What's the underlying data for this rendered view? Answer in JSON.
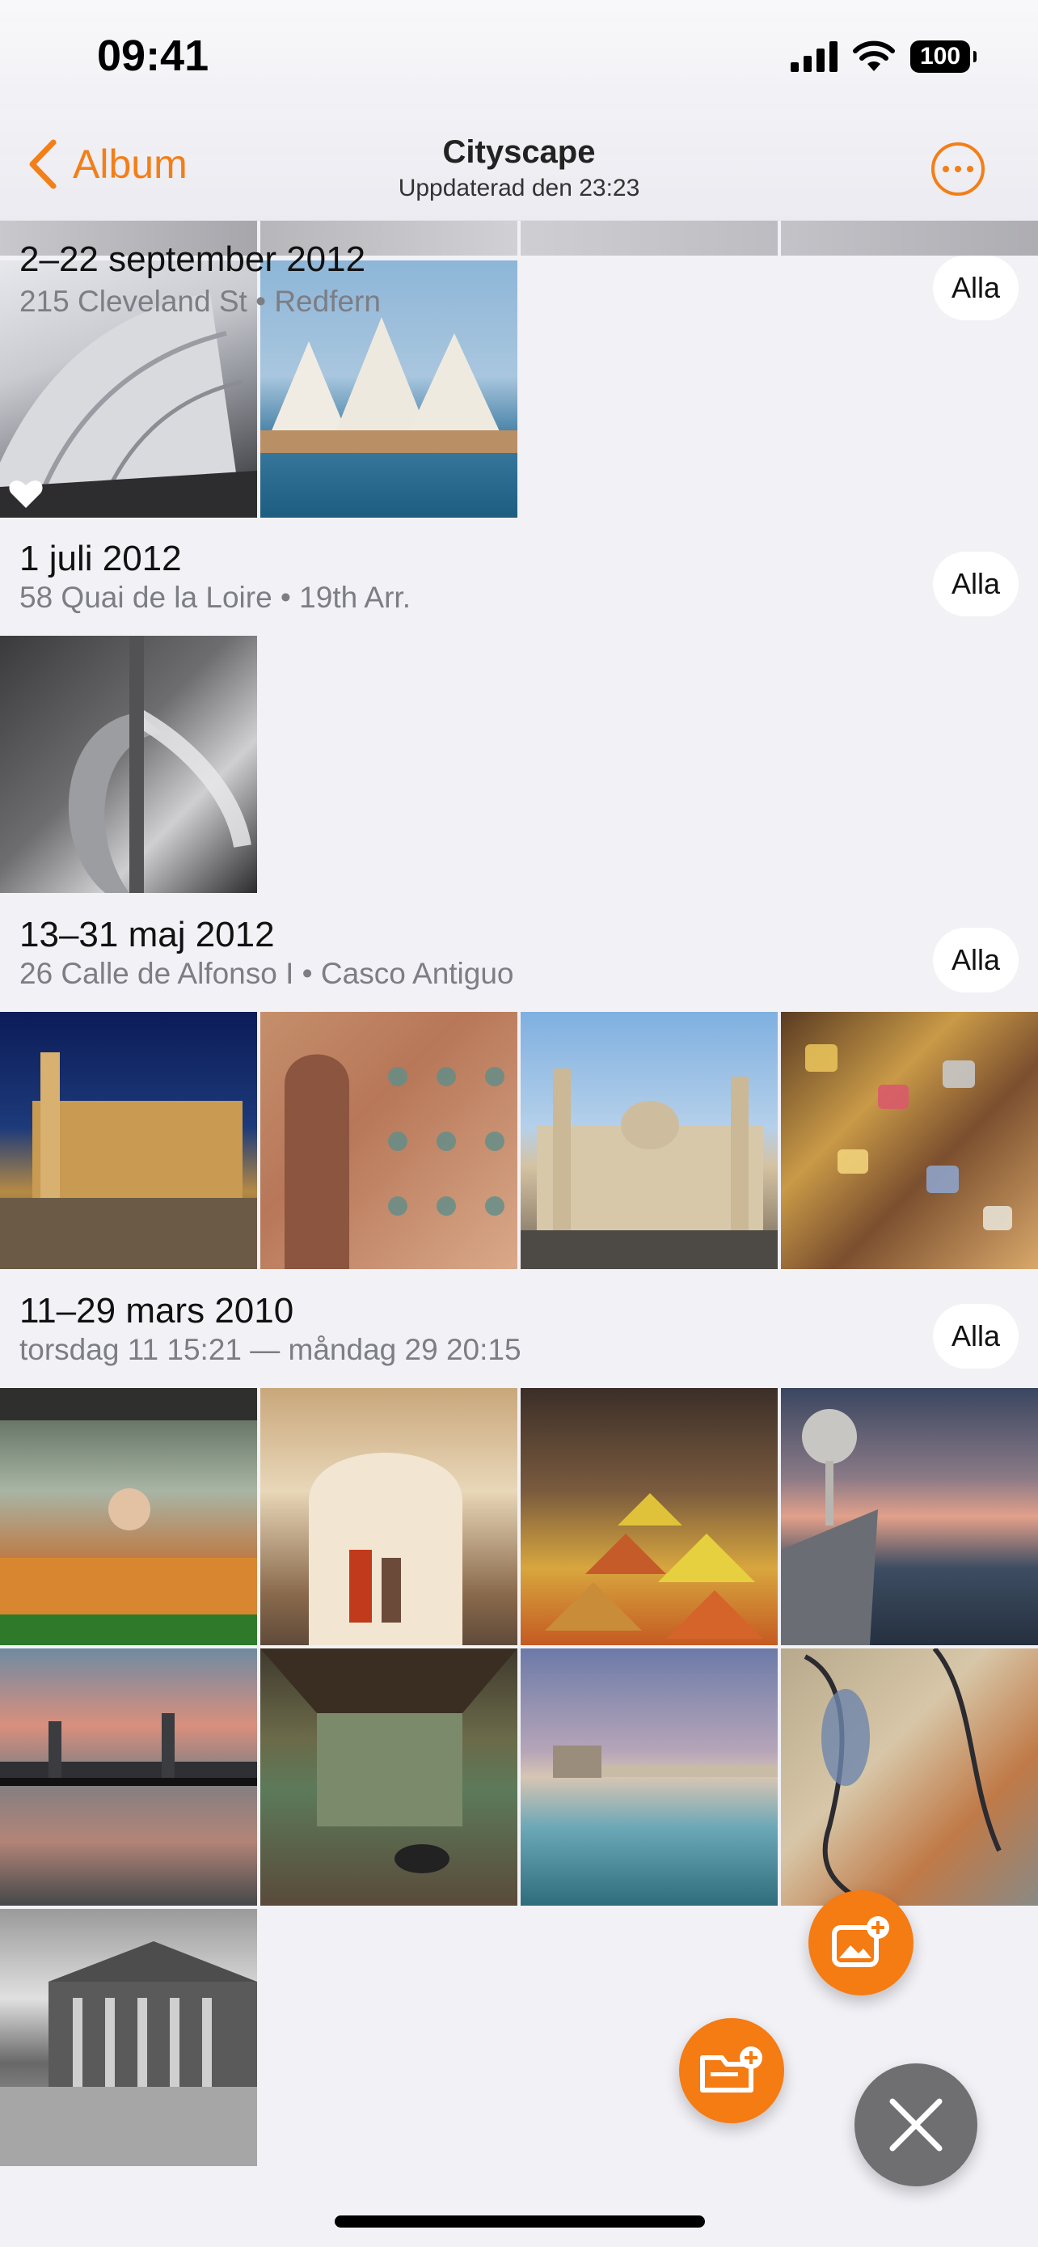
{
  "status_bar": {
    "time": "09:41",
    "battery": "100"
  },
  "nav": {
    "back_label": "Album",
    "title": "Cityscape",
    "subtitle": "Uppdaterad den 23:23"
  },
  "sections": [
    {
      "title": "2–22 september 2012",
      "subtitle": "215 Cleveland St • Redfern",
      "button": "Alla",
      "photos": [
        "Sydney Opera House shells",
        "Sydney Opera House from water"
      ]
    },
    {
      "title": "1 juli 2012",
      "subtitle": "58 Quai de la Loire • 19th Arr.",
      "button": "Alla",
      "photos": [
        "Water fountain pipe"
      ]
    },
    {
      "title": "13–31 maj 2012",
      "subtitle": "26 Calle de Alfonso I • Casco Antiguo",
      "button": "Alla",
      "photos": [
        "Basilica at night",
        "Mudejar tiled wall",
        "Basilica of El Pilar",
        "Love padlocks"
      ]
    },
    {
      "title": "11–29 mars 2010",
      "subtitle": "torsdag 11 15:21 — måndag 29 20:15",
      "button": "Alla",
      "photos": [
        "Market food stall",
        "Moorish archway street",
        "Spice market",
        "Waterfront promenade at dusk",
        "Industrial bridge reflection",
        "Abandoned room with graffiti",
        "Pier reflection at dusk",
        "Street art mural",
        "Neoclassical building black and white"
      ]
    }
  ],
  "colors": {
    "accent": "#f27f18",
    "background": "#f2f1f6",
    "fab": "#f57b13",
    "close_fab": "#6f6f72"
  },
  "icons": [
    "chevron-left-icon",
    "ellipsis-icon",
    "heart-icon",
    "add-photo-icon",
    "add-folder-icon",
    "close-icon"
  ]
}
